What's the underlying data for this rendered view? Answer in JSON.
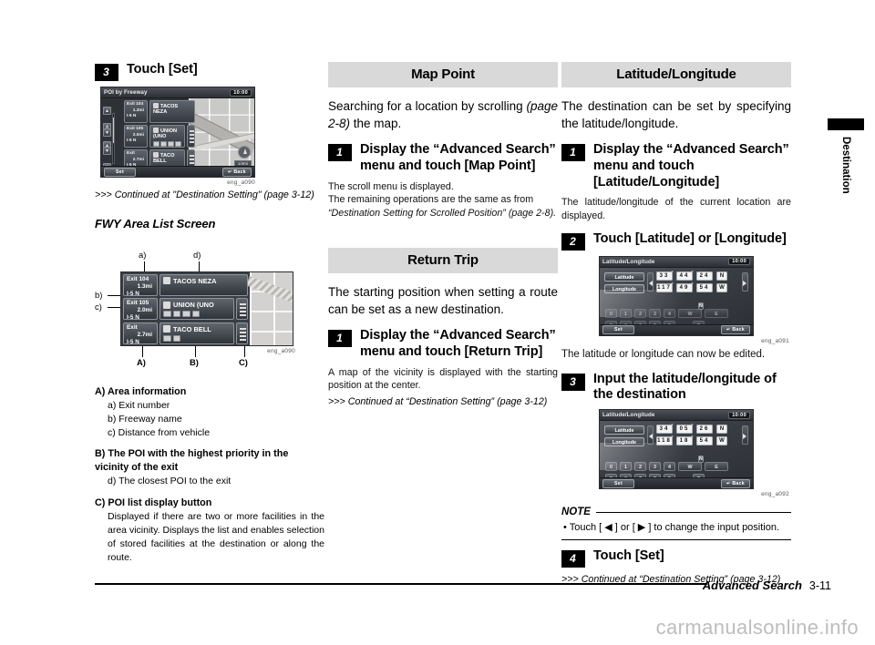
{
  "left_column": {
    "step3": {
      "num": "3",
      "title": "Touch [Set]"
    },
    "poi_screen": {
      "title": "POI by Freeway",
      "clock": "10:00",
      "scale": "1/4mi",
      "set_label": "Set",
      "back_label": "Back",
      "rows": [
        {
          "exit": "Exit 104",
          "distance": "1.3mi",
          "road": "I-5 N",
          "name": "TACOS NEZA",
          "has_list_button": false
        },
        {
          "exit": "Exit 105",
          "distance": "2.0mi",
          "road": "I-5 N",
          "name": "UNION (UNO",
          "has_list_button": true
        },
        {
          "exit": "Exit",
          "distance": "2.7mi",
          "road": "I-5 N",
          "name": "TACO BELL",
          "has_list_button": true
        }
      ]
    },
    "poi_fig_code": "eng_a090",
    "continued_note": ">>> Continued at \"Destination Setting\" (page 3-12)",
    "fwy_heading": "FWY Area List Screen",
    "fwy_screen": {
      "rows": [
        {
          "exit": "Exit 104",
          "distance": "1.3mi",
          "road": "I-5 N",
          "name": "TACOS NEZA",
          "has_list_button": false
        },
        {
          "exit": "Exit 105",
          "distance": "2.0mi",
          "road": "I-5 N",
          "name": "UNION (UNO",
          "has_list_button": true
        },
        {
          "exit": "Exit",
          "distance": "2.7mi",
          "road": "I-5 N",
          "name": "TACO BELL",
          "has_list_button": true
        }
      ]
    },
    "fwy_fig_code": "eng_a090",
    "callouts": {
      "a": "a)",
      "b": "b)",
      "c": "c)",
      "d": "d)",
      "A": "A)",
      "B": "B)",
      "C": "C)"
    },
    "definitions": [
      {
        "heading": "A) Area information",
        "items": [
          "a) Exit number",
          "b) Freeway name",
          "c) Distance from vehicle"
        ],
        "paragraph": ""
      },
      {
        "heading": "B) The POI with the highest priority in the vicinity of the exit",
        "items": [
          "d) The closest POI to the exit"
        ],
        "paragraph": ""
      },
      {
        "heading": "C) POI list display button",
        "items": [],
        "paragraph": "Displayed if there are two or more facilities in the area vicinity. Displays the list and enables selection of stored facilities at the destination or along the route."
      }
    ]
  },
  "mid_column": {
    "map_point": {
      "section_title": "Map Point",
      "intro_a": "Searching for a location by scrolling ",
      "intro_italic": "(page 2-8)",
      "intro_b": " the map.",
      "step_num": "1",
      "step_title": "Display the “Advanced Search” menu and touch [Map Point]",
      "body1": "The scroll menu is displayed.",
      "body2": "The remaining operations are the same as from",
      "body3": "“Destination Setting for Scrolled Position” (page 2-8)."
    },
    "return_trip": {
      "section_title": "Return Trip",
      "intro": "The starting position when setting a route can be set as a new destination.",
      "step_num": "1",
      "step_title": "Display the “Advanced Search” menu and touch [Return Trip]",
      "body1": "A map of the vicinity is displayed with the starting position at the center.",
      "continued": ">>> Continued at “Destination Setting” (page 3-12)"
    }
  },
  "right_column": {
    "section_title": "Latitude/Longitude",
    "intro": "The destination can be set by specifying the latitude/longitude.",
    "step1": {
      "num": "1",
      "title": "Display the “Advanced Search” menu and touch [Latitude/Longitude]",
      "body": "The latitude/longitude of the current location are displayed."
    },
    "step2": {
      "num": "2",
      "title": "Touch [Latitude] or [Longitude]"
    },
    "ll_screen_1": {
      "title": "Latitude/Longitude",
      "clock": "10:00",
      "latitude_label": "Latitude",
      "longitude_label": "Longitude",
      "latitude": {
        "deg": "33",
        "min": "44",
        "sec": "24",
        "hemi": "N"
      },
      "longitude": {
        "deg": "117",
        "min": "49",
        "sec": "54",
        "hemi": "W"
      },
      "keys_row1": [
        "0",
        "1",
        "2",
        "3",
        "4",
        "W",
        "E"
      ],
      "keys_row2": [
        "5",
        "6",
        "7",
        "8",
        "9",
        "S"
      ],
      "extra_key": "N",
      "set_label": "Set",
      "back_label": "Back"
    },
    "ll_fig_code_1": "eng_a091",
    "after_step2": "The latitude or longitude can now be edited.",
    "step3": {
      "num": "3",
      "title": "Input the latitude/longitude of the destination"
    },
    "ll_screen_2": {
      "title": "Latitude/Longitude",
      "clock": "10:00",
      "latitude_label": "Latitude",
      "longitude_label": "Longitude",
      "latitude": {
        "deg": "34",
        "min": "05",
        "sec": "26",
        "hemi": "N"
      },
      "longitude": {
        "deg": "118",
        "min": "18",
        "sec": "54",
        "hemi": "W"
      },
      "keys_row1": [
        "0",
        "1",
        "2",
        "3",
        "4",
        "W",
        "E"
      ],
      "keys_row2": [
        "5",
        "6",
        "7",
        "8",
        "9",
        "S"
      ],
      "extra_key": "N",
      "set_label": "Set",
      "back_label": "Back"
    },
    "ll_fig_code_2": "eng_a092",
    "note": {
      "label": "NOTE",
      "text": "• Touch [ ◀ ] or [ ▶ ] to change the input position."
    },
    "step4": {
      "num": "4",
      "title": "Touch [Set]"
    },
    "continued": ">>> Continued at “Destination Setting” (page 3-12)"
  },
  "side_tab": {
    "label": "Destination"
  },
  "footer": {
    "chapter": "Advanced Search",
    "page": "3-11",
    "watermark": "carmanualsonline.info"
  }
}
